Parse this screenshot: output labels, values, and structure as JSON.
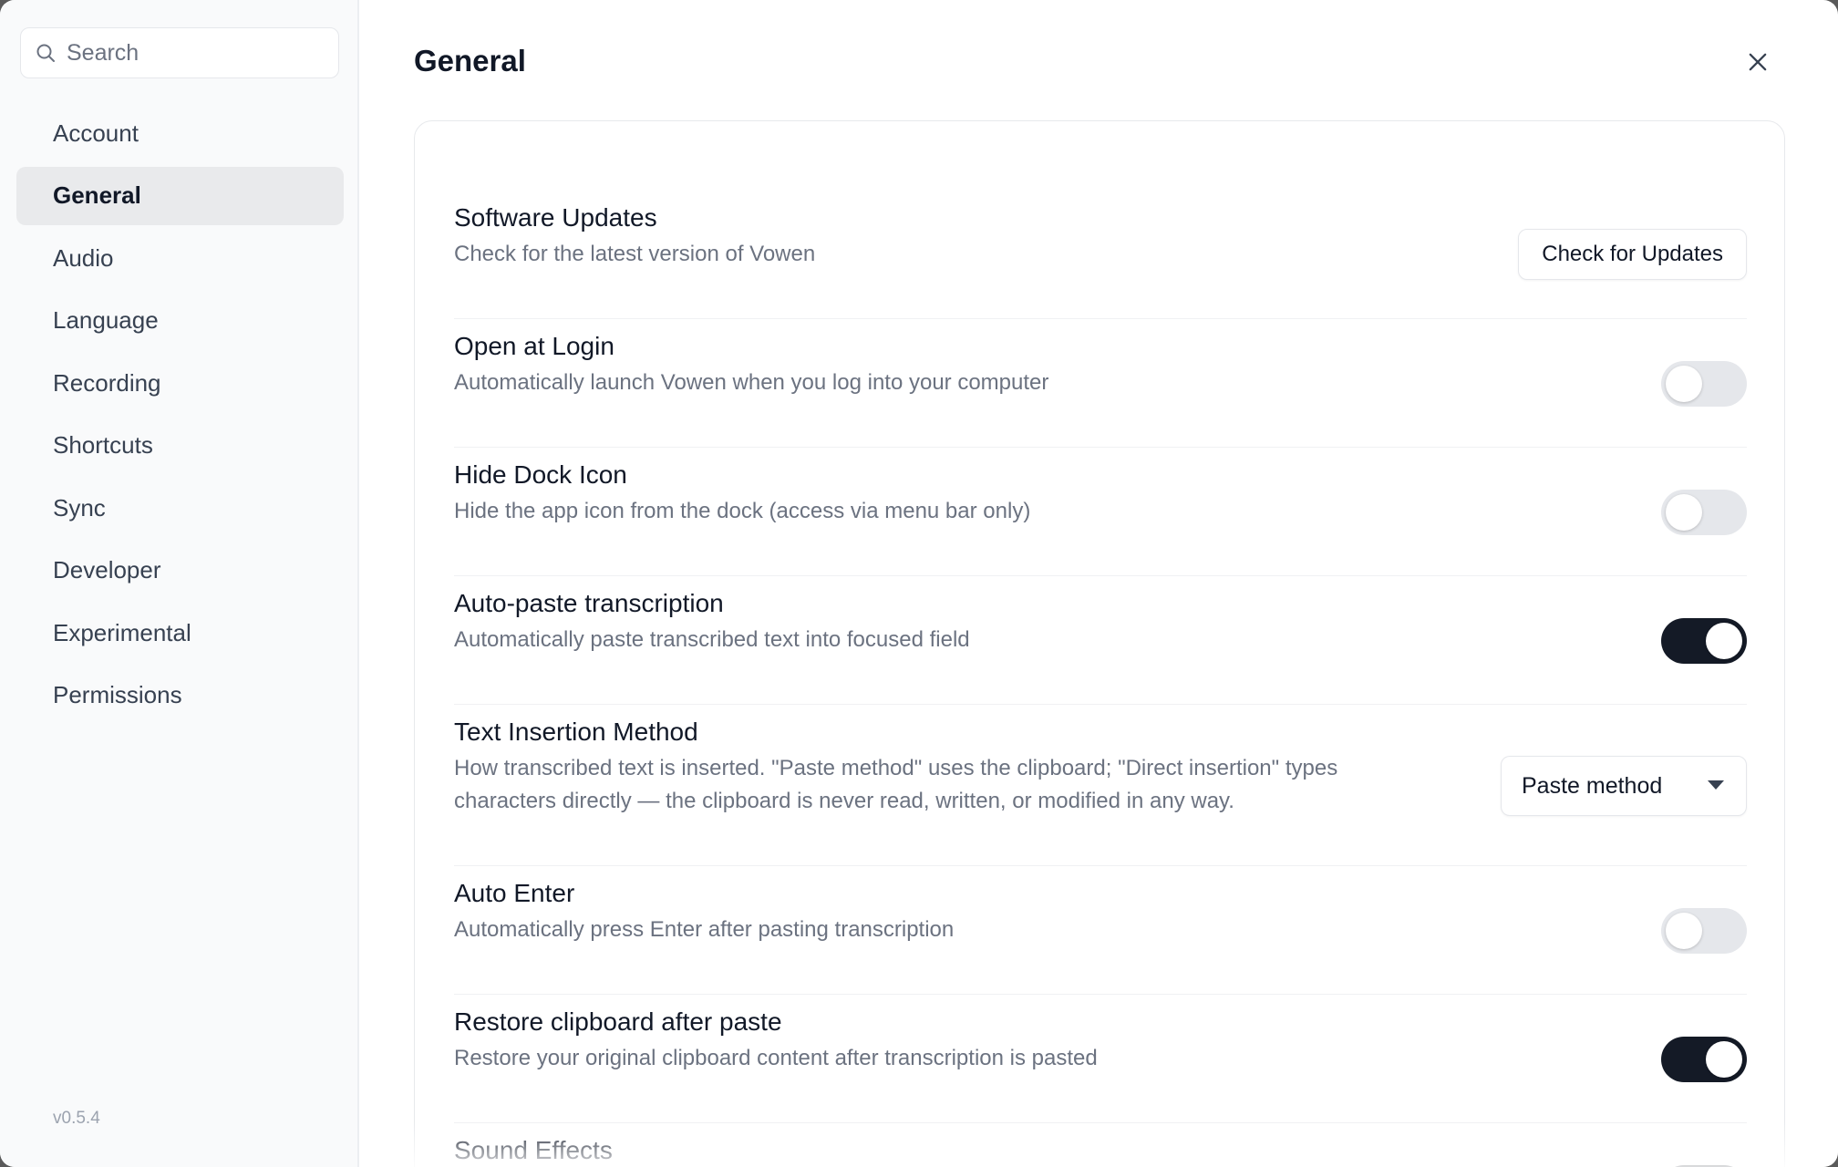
{
  "sidebar": {
    "search": {
      "placeholder": "Search",
      "icon": "search-icon"
    },
    "items": [
      {
        "label": "Account",
        "active": false
      },
      {
        "label": "General",
        "active": true
      },
      {
        "label": "Audio",
        "active": false
      },
      {
        "label": "Language",
        "active": false
      },
      {
        "label": "Recording",
        "active": false
      },
      {
        "label": "Shortcuts",
        "active": false
      },
      {
        "label": "Sync",
        "active": false
      },
      {
        "label": "Developer",
        "active": false
      },
      {
        "label": "Experimental",
        "active": false
      },
      {
        "label": "Permissions",
        "active": false
      }
    ],
    "version": "v0.5.4"
  },
  "main": {
    "title": "General",
    "close_icon": "close-icon",
    "settings": {
      "software_updates": {
        "title": "Software Updates",
        "description": "Check for the latest version of Vowen",
        "button_label": "Check for Updates"
      },
      "open_at_login": {
        "title": "Open at Login",
        "description": "Automatically launch Vowen when you log into your computer",
        "enabled": false
      },
      "hide_dock_icon": {
        "title": "Hide Dock Icon",
        "description": "Hide the app icon from the dock (access via menu bar only)",
        "enabled": false
      },
      "auto_paste": {
        "title": "Auto-paste transcription",
        "description": "Automatically paste transcribed text into focused field",
        "enabled": true
      },
      "text_insertion": {
        "title": "Text Insertion Method",
        "description_line1": "How transcribed text is inserted. \"Paste method\" uses the clipboard; \"Direct insertion\" types",
        "description_line2": "characters directly — the clipboard is never read, written, or modified in any way.",
        "selected": "Paste method"
      },
      "auto_enter": {
        "title": "Auto Enter",
        "description": "Automatically press Enter after pasting transcription",
        "enabled": false
      },
      "restore_clipboard": {
        "title": "Restore clipboard after paste",
        "description": "Restore your original clipboard content after transcription is pasted",
        "enabled": true
      },
      "sound_effects": {
        "title": "Sound Effects",
        "enabled": true
      }
    }
  },
  "colors": {
    "toggle_on": "#141a26",
    "toggle_off": "#e5e7eb",
    "sidebar_bg": "#f9fafb",
    "active_item_bg": "#e9eaec"
  }
}
